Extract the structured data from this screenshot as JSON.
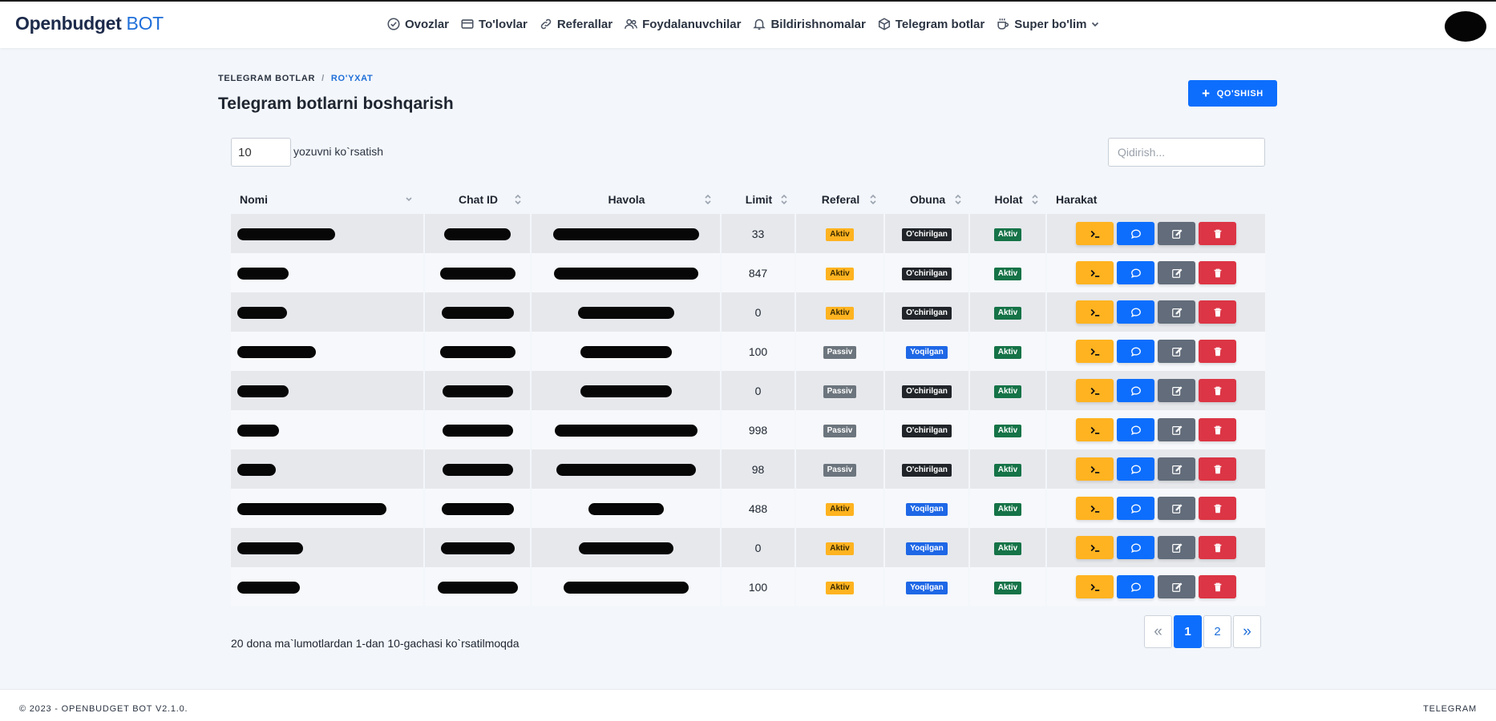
{
  "brand": {
    "name": "Openbudget",
    "accent": "BOT"
  },
  "nav": [
    {
      "label": "Ovozlar",
      "icon": "check-circle-icon"
    },
    {
      "label": "To'lovlar",
      "icon": "card-icon"
    },
    {
      "label": "Referallar",
      "icon": "link-icon"
    },
    {
      "label": "Foydalanuvchilar",
      "icon": "users-icon"
    },
    {
      "label": "Bildirishnomalar",
      "icon": "bell-icon"
    },
    {
      "label": "Telegram botlar",
      "icon": "box-icon"
    },
    {
      "label": "Super bo'lim",
      "icon": "coffee-icon"
    }
  ],
  "breadcrumb": {
    "parent": "TELEGRAM BOTLAR",
    "separator": "/",
    "current": "RO'YXAT"
  },
  "page_title": "Telegram botlarni boshqarish",
  "add_button": {
    "label": "QO'SHISH"
  },
  "controls": {
    "page_length": "10",
    "page_length_label": "yozuvni ko`rsatish",
    "search_placeholder": "Qidirish..."
  },
  "table": {
    "columns": [
      "Nomi",
      "Chat ID",
      "Havola",
      "Limit",
      "Referal",
      "Obuna",
      "Holat",
      "Harakat"
    ],
    "rows": [
      {
        "limit": "33",
        "referal": "Aktiv",
        "obuna": "O'chirilgan",
        "holat": "Aktiv"
      },
      {
        "limit": "847",
        "referal": "Aktiv",
        "obuna": "O'chirilgan",
        "holat": "Aktiv"
      },
      {
        "limit": "0",
        "referal": "Aktiv",
        "obuna": "O'chirilgan",
        "holat": "Aktiv"
      },
      {
        "limit": "100",
        "referal": "Passiv",
        "obuna": "Yoqilgan",
        "holat": "Aktiv"
      },
      {
        "limit": "0",
        "referal": "Passiv",
        "obuna": "O'chirilgan",
        "holat": "Aktiv"
      },
      {
        "limit": "998",
        "referal": "Passiv",
        "obuna": "O'chirilgan",
        "holat": "Aktiv"
      },
      {
        "limit": "98",
        "referal": "Passiv",
        "obuna": "O'chirilgan",
        "holat": "Aktiv"
      },
      {
        "limit": "488",
        "referal": "Aktiv",
        "obuna": "Yoqilgan",
        "holat": "Aktiv"
      },
      {
        "limit": "0",
        "referal": "Aktiv",
        "obuna": "Yoqilgan",
        "holat": "Aktiv"
      },
      {
        "limit": "100",
        "referal": "Aktiv",
        "obuna": "Yoqilgan",
        "holat": "Aktiv"
      }
    ]
  },
  "info_text": "20 dona ma`lumotlardan 1-dan 10-gachasi ko`rsatilmoqda",
  "pagination": {
    "prev": "«",
    "pages": [
      "1",
      "2"
    ],
    "current": "1",
    "next": "»"
  },
  "footer": {
    "copyright": "© 2023 - OPENBUDGET BOT V2.1.0.",
    "right": "TELEGRAM"
  },
  "colors": {
    "primary": "#0d6efd",
    "warning": "#ffb320",
    "danger": "#dc3545",
    "success": "#157347",
    "dark": "#212529",
    "secondary": "#6c757d"
  }
}
